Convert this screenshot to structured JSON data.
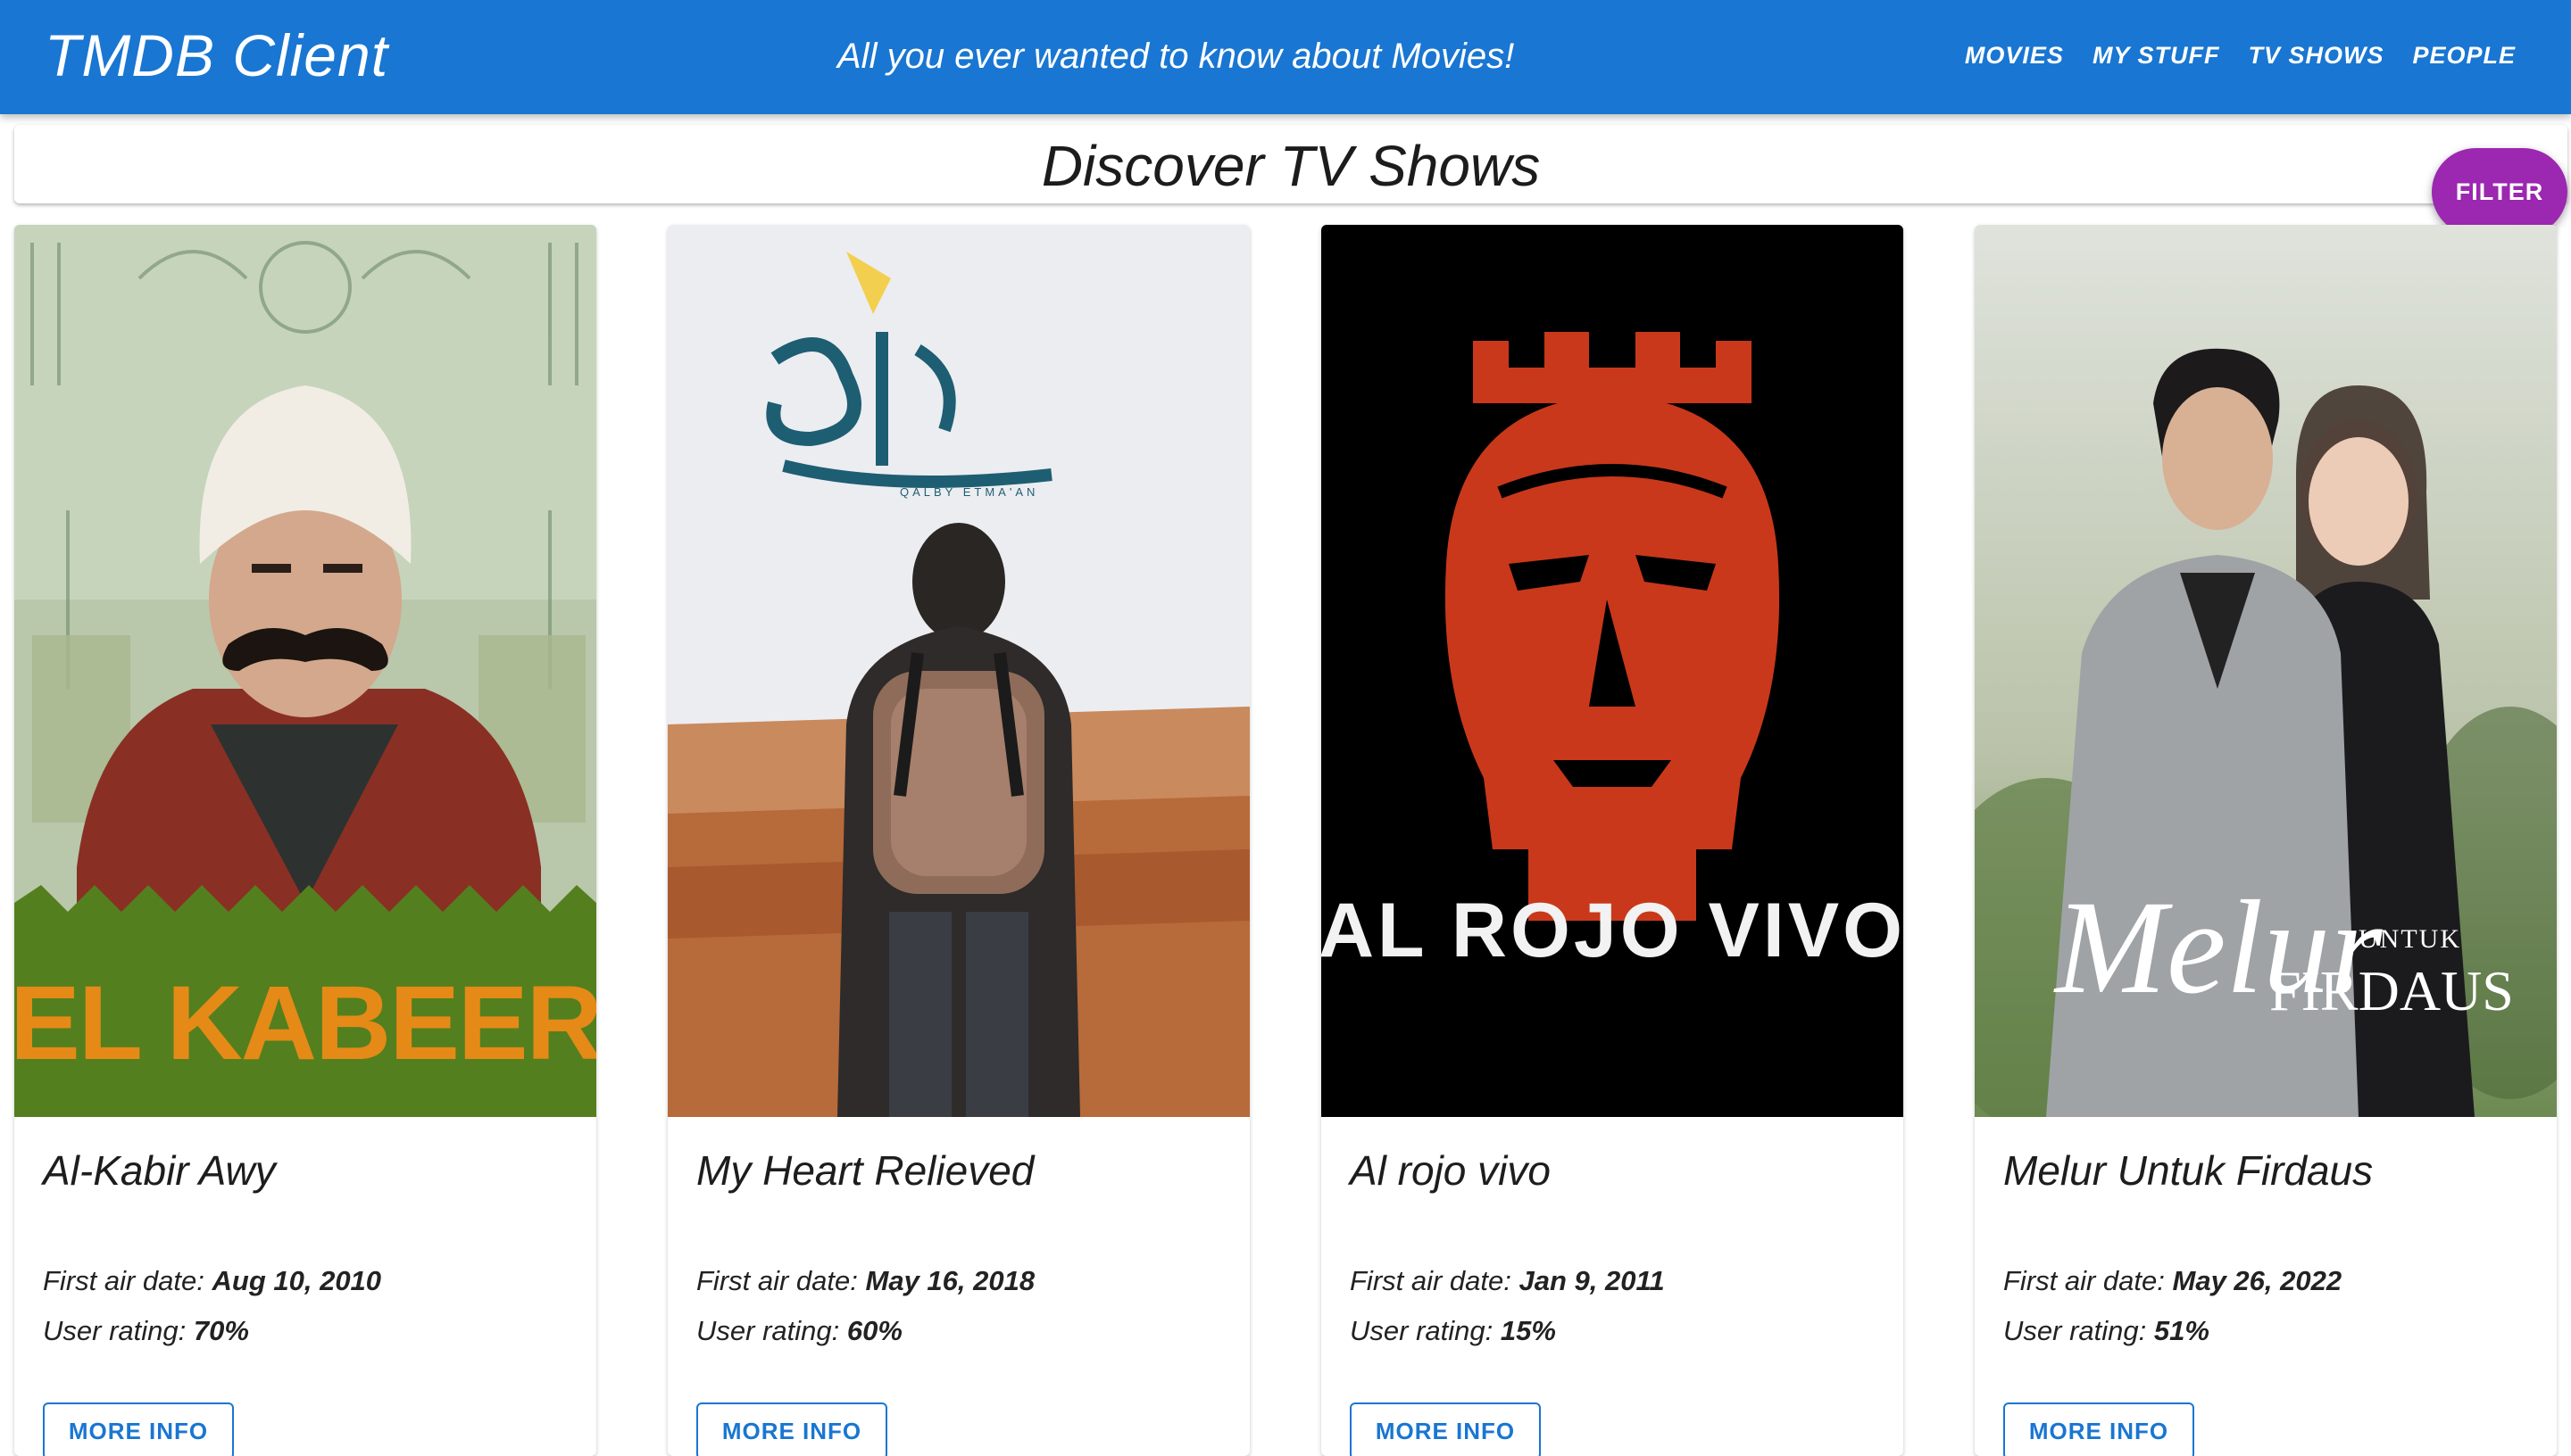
{
  "header": {
    "brand": "TMDB Client",
    "tagline": "All you ever wanted to know about Movies!",
    "nav": [
      "MOVIES",
      "MY STUFF",
      "TV SHOWS",
      "PEOPLE"
    ]
  },
  "section": {
    "title": "Discover TV Shows",
    "filter_label": "FILTER"
  },
  "labels": {
    "first_air_date": "First air date: ",
    "user_rating": "User rating: ",
    "more_info": "MORE INFO"
  },
  "shows": [
    {
      "title": "Al-Kabir Awy",
      "air_date": "Aug 10, 2010",
      "rating": "70%",
      "poster_text": "EL KABEER"
    },
    {
      "title": "My Heart Relieved",
      "air_date": "May 16, 2018",
      "rating": "60%",
      "poster_text": "QALBY ETMA'AN"
    },
    {
      "title": "Al rojo vivo",
      "air_date": "Jan 9, 2011",
      "rating": "15%",
      "poster_text": "AL ROJO VIVO"
    },
    {
      "title": "Melur Untuk Firdaus",
      "air_date": "May 26, 2022",
      "rating": "51%",
      "poster_text": "Melur",
      "poster_text_small": "UNTUK",
      "poster_text_2": "FIRDAUS"
    }
  ],
  "colors": {
    "appbar": "#1976d2",
    "filter": "#9c27b0",
    "accent": "#1976d2"
  }
}
